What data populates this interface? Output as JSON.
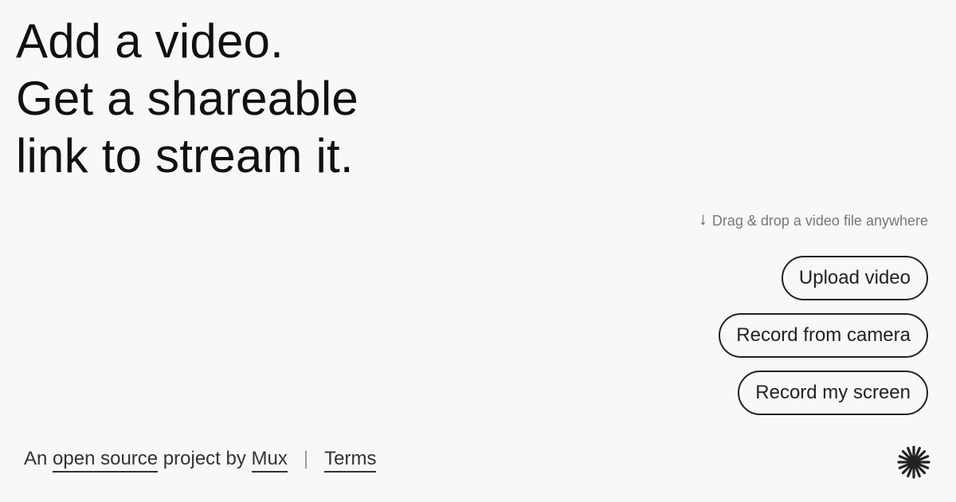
{
  "headline": {
    "line1": "Add a video.",
    "line2": "Get a shareable",
    "line3": "link to stream it."
  },
  "drop_hint": {
    "arrow": "↓",
    "text": "Drag & drop a video file anywhere"
  },
  "actions": {
    "upload": "Upload video",
    "camera": "Record from camera",
    "screen": "Record my screen"
  },
  "footer": {
    "prefix": "An",
    "open_source": "open source",
    "middle": "project by",
    "mux": "Mux",
    "separator": "|",
    "terms": "Terms"
  },
  "logo": {
    "icon": "asterisk-logo-icon",
    "color": "#222222"
  }
}
